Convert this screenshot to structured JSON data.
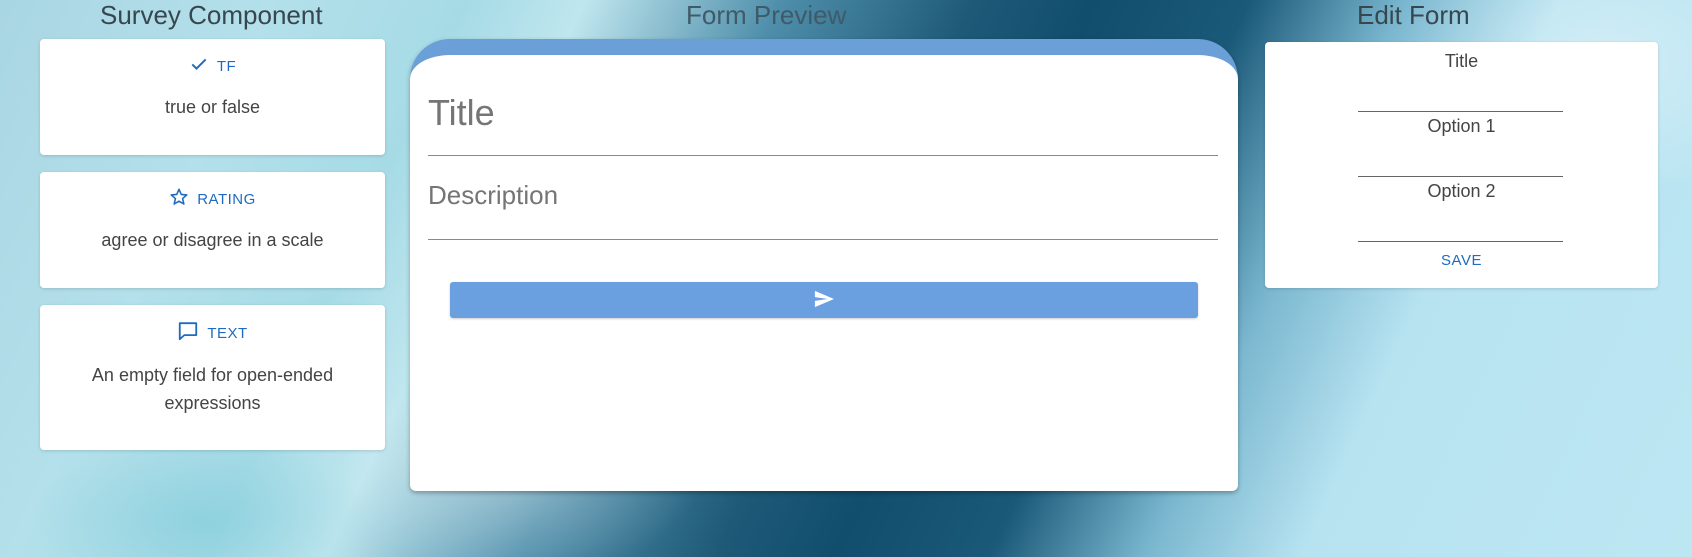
{
  "headers": {
    "survey_component": "Survey Component",
    "form_preview": "Form Preview",
    "edit_form": "Edit Form"
  },
  "components": [
    {
      "icon": "check-icon",
      "label": "TF",
      "description": "true or false"
    },
    {
      "icon": "star-outline-icon",
      "label": "RATING",
      "description": "agree or disagree in a scale"
    },
    {
      "icon": "comment-icon",
      "label": "TEXT",
      "description": "An empty field for open-ended expressions"
    }
  ],
  "preview": {
    "title_placeholder": "Title",
    "description_placeholder": "Description",
    "submit_icon": "send-icon"
  },
  "edit_form": {
    "title_label": "Title",
    "option1_label": "Option 1",
    "option2_label": "Option 2",
    "save_label": "SAVE"
  },
  "colors": {
    "accent": "#1e6bc0",
    "preview_bar": "#6a9fd8",
    "submit_button": "#6a9fe0"
  }
}
